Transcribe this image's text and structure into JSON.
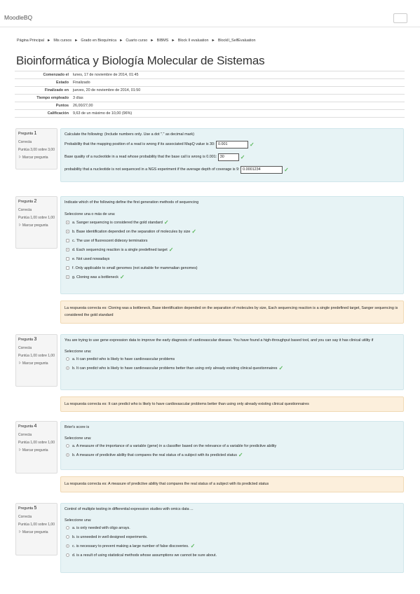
{
  "navbar": {
    "brand": "MoodleBQ"
  },
  "breadcrumb": [
    "Página Principal",
    "Mis cursos",
    "Grado en Bioquímica",
    "Cuarto curso",
    "BIBMS",
    "Block II evaluation",
    "BlockII_SelfEvaluation"
  ],
  "breadcrumb_sep": "►",
  "page_title": "Bioinformática y Biología Molecular de Sistemas",
  "summary": [
    {
      "label": "Comenzado el",
      "value": "lunes, 17 de noviembre de 2014, 01:45"
    },
    {
      "label": "Estado",
      "value": "Finalizado"
    },
    {
      "label": "Finalizado en",
      "value": "jueves, 20 de noviembre de 2014, 01:50"
    },
    {
      "label": "Tiempo empleado",
      "value": "3 días"
    },
    {
      "label": "Puntos",
      "value": "26,00/27,00"
    },
    {
      "label": "Calificación",
      "value": "9,63 de un máximo de 10,00 (96%)"
    }
  ],
  "common": {
    "status": "Correcta",
    "flag": "Marcar pregunta",
    "tick": "✓"
  },
  "q1": {
    "label": "Pregunta",
    "num": "1",
    "grade": "Puntúa 3,00 sobre 3,00",
    "text": "Calculate the following: (Include numbers only. Use a dot \".\" as decimal mark)",
    "parts": [
      {
        "text": "Probability that the mapping position of a read is wrong if its associated MapQ value is 30:",
        "answer": "0.001"
      },
      {
        "text": "Base quality of a nucleotide in a read whose probability that the base call is wrong is 0.001:",
        "answer": "30"
      },
      {
        "text": "probability that a nucleotide is not sequenced in a NGS experiment if the average depth of coverage is 9:",
        "answer": "0.0001234"
      }
    ]
  },
  "q2": {
    "label": "Pregunta",
    "num": "2",
    "grade": "Puntúa 1,00 sobre 1,00",
    "text": "Indicate which of the following define the first generation methods of sequencing",
    "prompt": "Seleccione una o más de una:",
    "options": [
      "a. Sanger sequencing is considered the gold standard",
      "b. Base identification depended on the separation of molecules by size",
      "c. The use of fluorescent dideoxy terminators",
      "d. Each sequencing reaction is a single predefined target",
      "e. Not used nowadays",
      "f. Only applicable to small genomes (not suitable for mammalian genomes)",
      "g. Cloning was a bottleneck"
    ],
    "feedback": "La respuesta correcta es: Cloning was a bottleneck, Base identification depended on the separation of molecules by size, Each sequencing reaction is a single predefined target, Sanger sequencing is considered the gold standard"
  },
  "q3": {
    "label": "Pregunta",
    "num": "3",
    "grade": "Puntúa 1,00 sobre 1,00",
    "text": "You are trying to use gene expression data to improve the early diagnosis of cardiovascular disease. You have found a high-throughput based tool, and you can say it has clinical utility if",
    "prompt": "Seleccione una:",
    "options": [
      "a. It can predict who is likely to have cardiovascular problems",
      "b. It can predict who is likely to have cardiovascular problems better than using only already existing clinical questionnaires"
    ],
    "feedback": "La respuesta correcta es: It can predict who is likely to have cardiovascular problems better than using only already existing clinical questionnaires"
  },
  "q4": {
    "label": "Pregunta",
    "num": "4",
    "grade": "Puntúa 1,00 sobre 1,00",
    "text": "Brier's score is",
    "prompt": "Seleccione una:",
    "options": [
      "a. A measure of the importance of a variable (gene) in a classifier based on the relevance of a variable for predictive ability",
      "b. A measure of predictive ability that compares the real status of a subject with its predicted status"
    ],
    "feedback": "La respuesta correcta es: A measure of predictive ability that compares the real status of a subject with its predicted status"
  },
  "q5": {
    "label": "Pregunta",
    "num": "5",
    "grade": "Puntúa 1,00 sobre 1,00",
    "text": "Control of multiple testing in differential expression studies with omics data ...",
    "prompt": "Seleccione una:",
    "options": [
      "a. is only needed with oligo arrays.",
      "b. is unneeded in well designed experiments.",
      "c. is necessary to prevent making a large number of false discoveries.",
      "d. is a result of using statistical methods whose assumptions we cannot be sure about."
    ]
  }
}
